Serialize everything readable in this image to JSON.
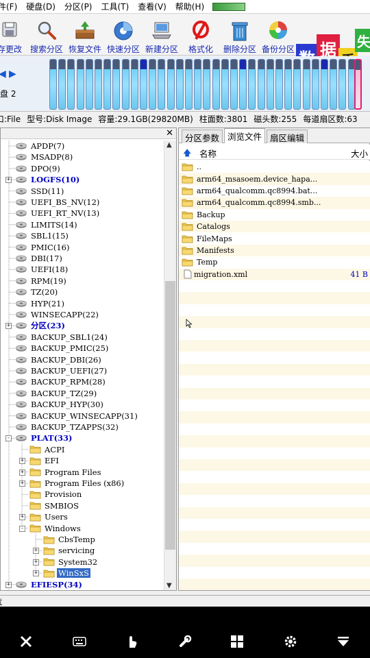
{
  "menu": {
    "items": [
      "文件(F)",
      "硬盘(D)",
      "分区(P)",
      "工具(T)",
      "查看(V)",
      "帮助(H)"
    ],
    "shown": [
      "件(F)",
      "硬盘(D)",
      "分区(P)",
      "工具(T)",
      "查看(V)",
      "帮助(H)"
    ]
  },
  "toolbar": {
    "save": "存更改",
    "search": "搜索分区",
    "recover": "恢复文件",
    "quick": "快速分区",
    "new": "新建分区",
    "format": "格式化",
    "delete": "删除分区",
    "backup": "备份分区"
  },
  "banner": {
    "c1": "数",
    "c2": "据",
    "c3": "丢",
    "c4": "失"
  },
  "disk": {
    "label": "盘 2"
  },
  "info": {
    "port": "口:File",
    "model": "型号:Disk Image",
    "capacity": "容量:29.1GB(29820MB)",
    "cylinders": "柱面数:3801",
    "heads": "磁头数:255",
    "sectors": "每道扇区数:63"
  },
  "tree": [
    {
      "label": "APDP(7)",
      "type": "disk",
      "level": 0,
      "exp": ""
    },
    {
      "label": "MSADP(8)",
      "type": "disk",
      "level": 0,
      "exp": ""
    },
    {
      "label": "DPO(9)",
      "type": "disk",
      "level": 0,
      "exp": ""
    },
    {
      "label": "LOGFS(10)",
      "type": "disk",
      "level": 0,
      "exp": "+",
      "style": "blue"
    },
    {
      "label": "SSD(11)",
      "type": "disk",
      "level": 0,
      "exp": ""
    },
    {
      "label": "UEFI_BS_NV(12)",
      "type": "disk",
      "level": 0,
      "exp": ""
    },
    {
      "label": "UEFI_RT_NV(13)",
      "type": "disk",
      "level": 0,
      "exp": ""
    },
    {
      "label": "LIMITS(14)",
      "type": "disk",
      "level": 0,
      "exp": ""
    },
    {
      "label": "SBL1(15)",
      "type": "disk",
      "level": 0,
      "exp": ""
    },
    {
      "label": "PMIC(16)",
      "type": "disk",
      "level": 0,
      "exp": ""
    },
    {
      "label": "DBI(17)",
      "type": "disk",
      "level": 0,
      "exp": ""
    },
    {
      "label": "UEFI(18)",
      "type": "disk",
      "level": 0,
      "exp": ""
    },
    {
      "label": "RPM(19)",
      "type": "disk",
      "level": 0,
      "exp": ""
    },
    {
      "label": "TZ(20)",
      "type": "disk",
      "level": 0,
      "exp": ""
    },
    {
      "label": "HYP(21)",
      "type": "disk",
      "level": 0,
      "exp": ""
    },
    {
      "label": "WINSECAPP(22)",
      "type": "disk",
      "level": 0,
      "exp": ""
    },
    {
      "label": "分区(23)",
      "type": "disk",
      "level": 0,
      "exp": "+",
      "style": "blue"
    },
    {
      "label": "BACKUP_SBL1(24)",
      "type": "disk",
      "level": 0,
      "exp": ""
    },
    {
      "label": "BACKUP_PMIC(25)",
      "type": "disk",
      "level": 0,
      "exp": ""
    },
    {
      "label": "BACKUP_DBI(26)",
      "type": "disk",
      "level": 0,
      "exp": ""
    },
    {
      "label": "BACKUP_UEFI(27)",
      "type": "disk",
      "level": 0,
      "exp": ""
    },
    {
      "label": "BACKUP_RPM(28)",
      "type": "disk",
      "level": 0,
      "exp": ""
    },
    {
      "label": "BACKUP_TZ(29)",
      "type": "disk",
      "level": 0,
      "exp": ""
    },
    {
      "label": "BACKUP_HYP(30)",
      "type": "disk",
      "level": 0,
      "exp": ""
    },
    {
      "label": "BACKUP_WINSECAPP(31)",
      "type": "disk",
      "level": 0,
      "exp": ""
    },
    {
      "label": "BACKUP_TZAPPS(32)",
      "type": "disk",
      "level": 0,
      "exp": ""
    },
    {
      "label": "PLAT(33)",
      "type": "disk",
      "level": 0,
      "exp": "-",
      "style": "blue"
    },
    {
      "label": "ACPI",
      "type": "folder",
      "level": 1,
      "exp": ""
    },
    {
      "label": "EFI",
      "type": "folder",
      "level": 1,
      "exp": "+"
    },
    {
      "label": "Program Files",
      "type": "folder",
      "level": 1,
      "exp": "+"
    },
    {
      "label": "Program Files (x86)",
      "type": "folder",
      "level": 1,
      "exp": "+"
    },
    {
      "label": "Provision",
      "type": "folder",
      "level": 1,
      "exp": ""
    },
    {
      "label": "SMBIOS",
      "type": "folder",
      "level": 1,
      "exp": ""
    },
    {
      "label": "Users",
      "type": "folder",
      "level": 1,
      "exp": "+"
    },
    {
      "label": "Windows",
      "type": "folder",
      "level": 1,
      "exp": "-"
    },
    {
      "label": "CbsTemp",
      "type": "folder",
      "level": 2,
      "exp": ""
    },
    {
      "label": "servicing",
      "type": "folder",
      "level": 2,
      "exp": "+"
    },
    {
      "label": "System32",
      "type": "folder",
      "level": 2,
      "exp": "+"
    },
    {
      "label": "WinSxS",
      "type": "folder",
      "level": 2,
      "exp": "+",
      "style": "sel"
    },
    {
      "label": "EFIESP(34)",
      "type": "disk",
      "level": 0,
      "exp": "+",
      "style": "blue"
    }
  ],
  "tabs": [
    "分区参数",
    "浏览文件",
    "扇区编辑"
  ],
  "columns": {
    "name": "名称",
    "size": "大小"
  },
  "files": [
    {
      "name": "..",
      "type": "folder-up",
      "size": ""
    },
    {
      "name": "arm64_msasoem.device_hapa...",
      "type": "folder",
      "size": ""
    },
    {
      "name": "arm64_qualcomm.qc8994.bat...",
      "type": "folder",
      "size": ""
    },
    {
      "name": "arm64_qualcomm.qc8994.smb...",
      "type": "folder",
      "size": ""
    },
    {
      "name": "Backup",
      "type": "folder",
      "size": ""
    },
    {
      "name": "Catalogs",
      "type": "folder",
      "size": ""
    },
    {
      "name": "FileMaps",
      "type": "folder",
      "size": ""
    },
    {
      "name": "Manifests",
      "type": "folder",
      "size": ""
    },
    {
      "name": "Temp",
      "type": "folder",
      "size": ""
    },
    {
      "name": "migration.xml",
      "type": "file",
      "size": "41 B"
    }
  ],
  "status": {
    "text": "就"
  },
  "colors": {
    "accent": "#1a2ab0",
    "selection": "#316ac5",
    "cylinder": "#5ac8f0",
    "selected_cylinder": "#e0206a"
  },
  "navbar_icons": [
    "close-icon",
    "keyboard-icon",
    "touch-icon",
    "wrench-icon",
    "windows-icon",
    "gear-icon",
    "dropdown-icon"
  ]
}
